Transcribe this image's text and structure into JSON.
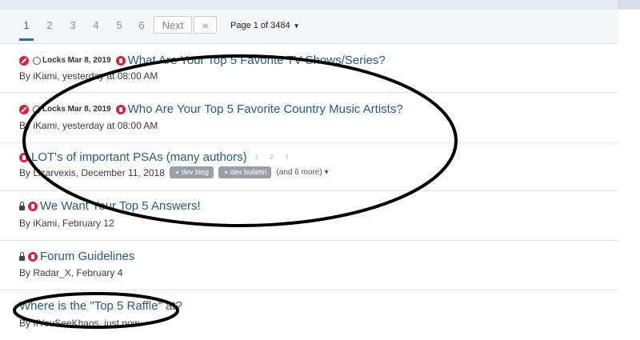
{
  "pagination": {
    "pages": [
      "1",
      "2",
      "3",
      "4",
      "5",
      "6"
    ],
    "next_label": "Next",
    "last_label": "»",
    "page_of_label": "Page 1 of 3484"
  },
  "threads": [
    {
      "locks_label": "Locks Mar 8, 2019",
      "title": "What Are Your Top 5 Favorite TV Shows/Series?",
      "meta": "By iKami, yesterday at 08:00 AM"
    },
    {
      "locks_label": "Locks Mar 8, 2019",
      "title": "Who Are Your Top 5 Favorite Country Music Artists?",
      "meta": "By iKami, yesterday at 08:00 AM"
    },
    {
      "title": "LOT's of important PSAs (many authors)",
      "mini_pages": "1 2 3",
      "meta": "By Lizarvexis, December 11, 2018",
      "tags": [
        "dev blog",
        "dev bulletin"
      ],
      "more": "(and 6 more)"
    },
    {
      "title": "We Want Your Top 5 Answers!",
      "meta": "By iKami, February 12"
    },
    {
      "title": "Forum Guidelines",
      "meta": "By Radar_X, February 4"
    },
    {
      "title": "Where is the \"Top 5 Raffle\" at?",
      "meta": "By IfYouSeeKhaos, just now"
    }
  ]
}
